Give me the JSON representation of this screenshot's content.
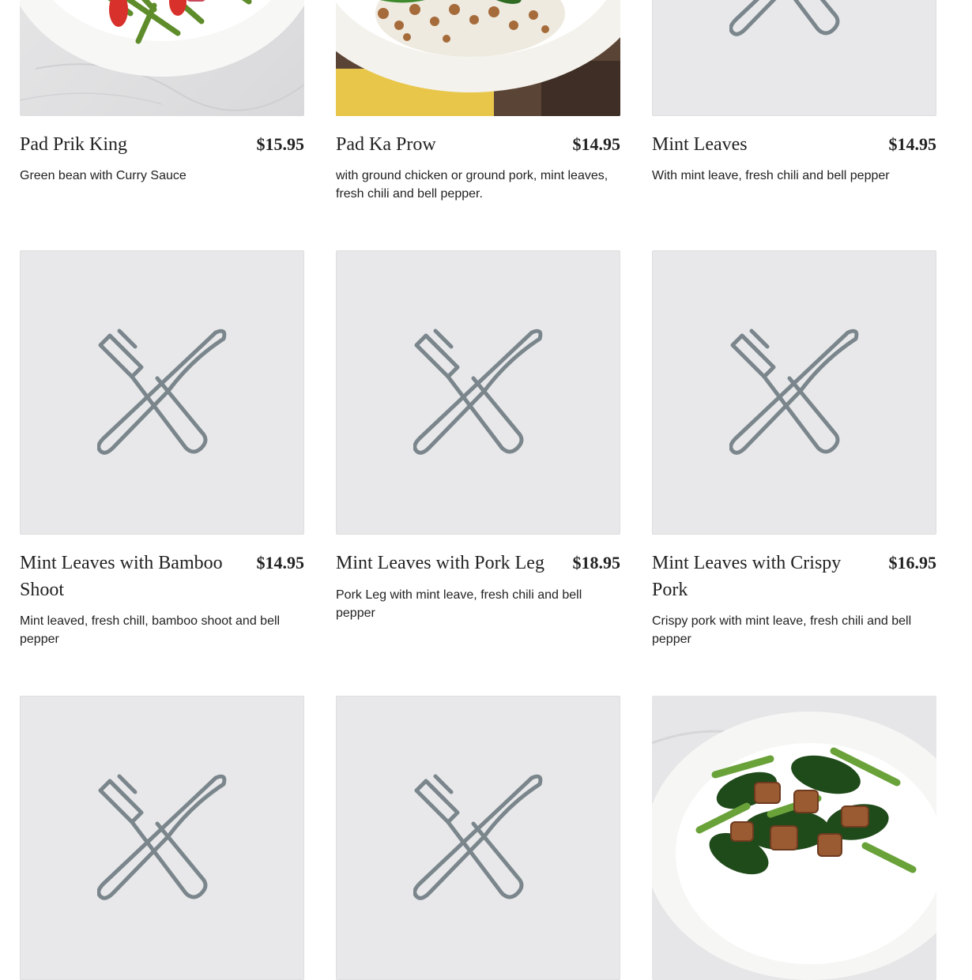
{
  "menu": {
    "items": [
      {
        "name": "Pad Prik King",
        "price": "$15.95",
        "description": "Green bean with Curry Sauce",
        "image": "green-bean-stirfry-photo"
      },
      {
        "name": "Pad Ka Prow",
        "price": "$14.95",
        "description": "with ground chicken or ground pork, mint leaves, fresh chili and bell pepper.",
        "image": "ground-meat-basil-photo"
      },
      {
        "name": "Mint Leaves",
        "price": "$14.95",
        "description": "With mint leave, fresh chili and bell pepper",
        "image": "utensils-placeholder-icon"
      },
      {
        "name": "Mint Leaves with Bamboo Shoot",
        "price": "$14.95",
        "description": "Mint leaved, fresh chill, bamboo shoot and bell pepper",
        "image": "utensils-placeholder-icon"
      },
      {
        "name": "Mint Leaves with Pork Leg",
        "price": "$18.95",
        "description": "Pork Leg with mint leave, fresh chili and bell pepper",
        "image": "utensils-placeholder-icon"
      },
      {
        "name": "Mint Leaves with Crispy Pork",
        "price": "$16.95",
        "description": "Crispy pork with mint leave, fresh chili and bell pepper",
        "image": "utensils-placeholder-icon"
      }
    ],
    "next_row_images": [
      "utensils-placeholder-icon",
      "utensils-placeholder-icon",
      "crispy-pork-greens-photo"
    ]
  },
  "colors": {
    "placeholder_bg": "#e8e8ea",
    "placeholder_icon": "#7a868c",
    "text": "#222222"
  }
}
